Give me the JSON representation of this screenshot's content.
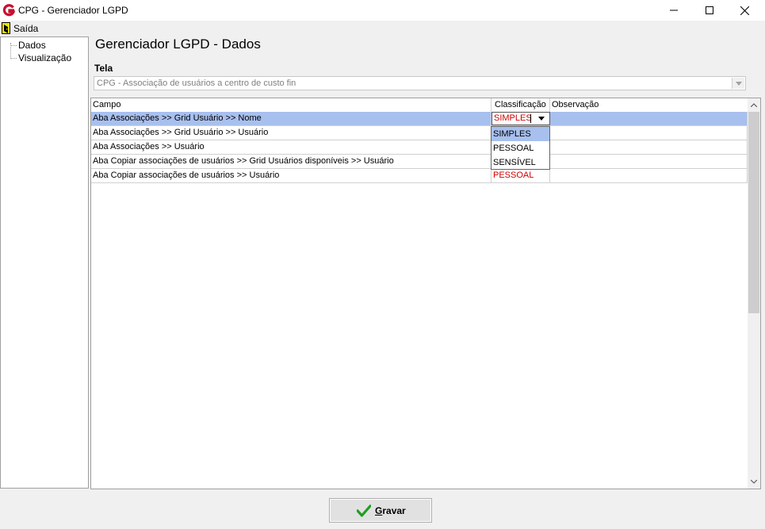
{
  "window": {
    "title": "CPG - Gerenciador LGPD",
    "controls": {
      "minimize": "—",
      "maximize": "☐",
      "close": "✕"
    }
  },
  "menu": {
    "items": [
      {
        "label": "Saída",
        "icon": "exit-door-icon"
      }
    ]
  },
  "sidebar": {
    "items": [
      {
        "label": "Dados"
      },
      {
        "label": "Visualização"
      }
    ]
  },
  "main": {
    "title": "Gerenciador LGPD - Dados",
    "tela_label": "Tela",
    "tela_value": "CPG - Associação de usuários a centro de custo fin"
  },
  "grid": {
    "columns": [
      "Campo",
      "Classificação",
      "Observação"
    ],
    "rows": [
      {
        "campo": "Aba Associações >> Grid Usuário >> Nome",
        "classificacao": "SIMPLES",
        "observacao": "",
        "selected": true
      },
      {
        "campo": "Aba Associações >> Grid Usuário >> Usuário",
        "classificacao": "",
        "observacao": ""
      },
      {
        "campo": "Aba Associações >> Usuário",
        "classificacao": "",
        "observacao": ""
      },
      {
        "campo": "Aba Copiar associações de usuários >> Grid Usuários disponíveis >> Usuário",
        "classificacao": "",
        "observacao": ""
      },
      {
        "campo": "Aba Copiar associações de usuários >> Usuário",
        "classificacao": "PESSOAL",
        "observacao": ""
      }
    ],
    "dropdown_options": [
      "SIMPLES",
      "PESSOAL",
      "SENSÍVEL"
    ],
    "dropdown_selected": "SIMPLES"
  },
  "footer": {
    "save_label_first": "G",
    "save_label_rest": "ravar",
    "icon": "checkmark-icon"
  },
  "colors": {
    "selection": "#a8c0ee",
    "classification_text": "#d00000",
    "app_icon_red": "#c8102e"
  }
}
